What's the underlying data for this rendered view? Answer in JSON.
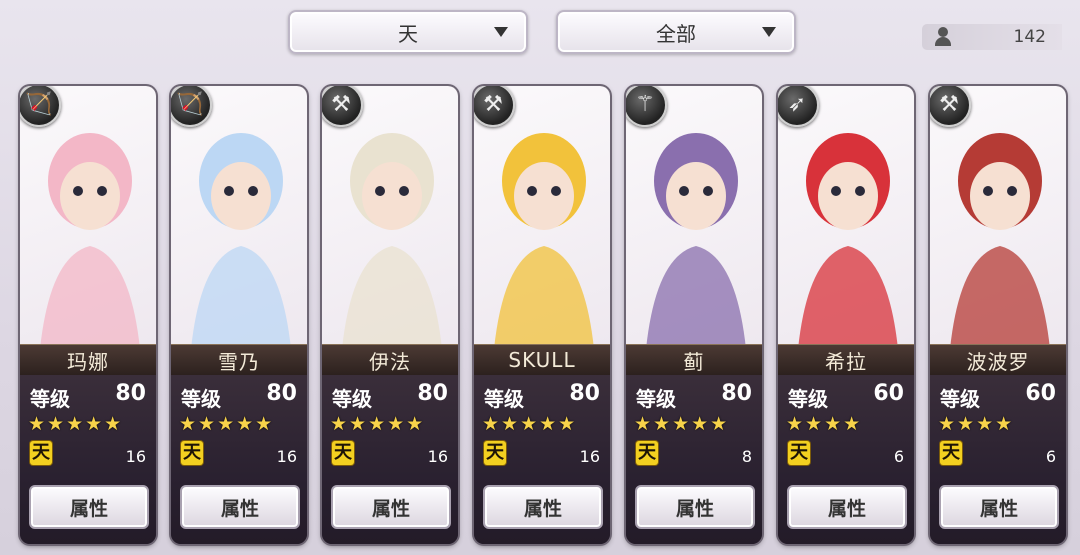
{
  "filters": {
    "rank_filter": "天",
    "category_filter": "全部"
  },
  "counter": {
    "value": "142"
  },
  "labels": {
    "level": "等级",
    "attributes_button": "属性",
    "rank_badge": "天"
  },
  "cards": [
    {
      "name": "玛娜",
      "level": "80",
      "stars": "★★★★★",
      "count": "16",
      "weapon_icon": "bow-icon",
      "theme": "#f3b7c7"
    },
    {
      "name": "雪乃",
      "level": "80",
      "stars": "★★★★★",
      "count": "16",
      "weapon_icon": "bow-icon",
      "theme": "#bcd7f4"
    },
    {
      "name": "伊法",
      "level": "80",
      "stars": "★★★★★",
      "count": "16",
      "weapon_icon": "hammer-icon",
      "theme": "#e9e2d0"
    },
    {
      "name": "SKULL",
      "level": "80",
      "stars": "★★★★★",
      "count": "16",
      "weapon_icon": "hammer-icon",
      "theme": "#f2c23b"
    },
    {
      "name": "蓟",
      "level": "80",
      "stars": "★★★★★",
      "count": "8",
      "weapon_icon": "staff-icon",
      "theme": "#8a6fae"
    },
    {
      "name": "希拉",
      "level": "60",
      "stars": "★★★★",
      "count": "6",
      "weapon_icon": "spear-icon",
      "theme": "#d8323a"
    },
    {
      "name": "波波罗",
      "level": "60",
      "stars": "★★★★",
      "count": "6",
      "weapon_icon": "hammer-icon",
      "theme": "#b53b35"
    }
  ]
}
